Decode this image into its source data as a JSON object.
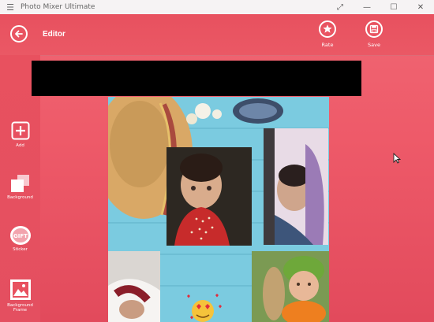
{
  "window": {
    "title": "Photo Mixer Ultimate",
    "controls": [
      "expand-icon",
      "minimize-icon",
      "maximize-icon",
      "close-icon"
    ]
  },
  "header": {
    "title": "Editor",
    "actions": [
      {
        "label": "Rate",
        "icon": "star-icon"
      },
      {
        "label": "Save",
        "icon": "save-icon"
      }
    ]
  },
  "sidebar": {
    "items": [
      {
        "label": "Add",
        "icon": "add-icon"
      },
      {
        "label": "Background",
        "icon": "background-icon"
      },
      {
        "label": "Sticker",
        "icon": "gift-sticker-icon",
        "badge": "GIFT"
      },
      {
        "label": "Background Frame",
        "icon": "frame-icon"
      }
    ]
  },
  "colors": {
    "accent": "#e8515f",
    "accent_light": "#f06673",
    "collage_background": "#72c8df"
  }
}
